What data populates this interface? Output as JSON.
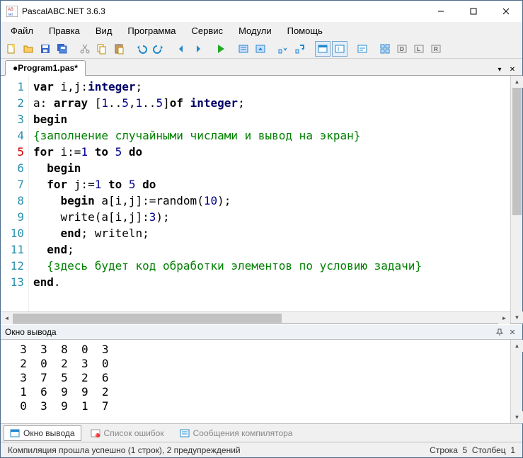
{
  "window": {
    "title": "PascalABC.NET 3.6.3"
  },
  "menus": [
    "Файл",
    "Правка",
    "Вид",
    "Программа",
    "Сервис",
    "Модули",
    "Помощь"
  ],
  "tab": {
    "label": "●Program1.pas*"
  },
  "gutter": {
    "lines": [
      "1",
      "2",
      "3",
      "4",
      "5",
      "6",
      "7",
      "8",
      "9",
      "10",
      "11",
      "12",
      "13"
    ],
    "current": 5
  },
  "code_lines": [
    {
      "segs": [
        {
          "t": "var ",
          "c": "kw"
        },
        {
          "t": "i,j:",
          "c": ""
        },
        {
          "t": "integer",
          "c": "type"
        },
        {
          "t": ";",
          "c": ""
        }
      ]
    },
    {
      "segs": [
        {
          "t": "a: ",
          "c": ""
        },
        {
          "t": "array ",
          "c": "kw"
        },
        {
          "t": "[",
          "c": ""
        },
        {
          "t": "1",
          "c": "num"
        },
        {
          "t": "..",
          "c": ""
        },
        {
          "t": "5",
          "c": "num"
        },
        {
          "t": ",",
          "c": ""
        },
        {
          "t": "1",
          "c": "num"
        },
        {
          "t": "..",
          "c": ""
        },
        {
          "t": "5",
          "c": "num"
        },
        {
          "t": "]",
          "c": ""
        },
        {
          "t": "of ",
          "c": "kw"
        },
        {
          "t": "integer",
          "c": "type"
        },
        {
          "t": ";",
          "c": ""
        }
      ]
    },
    {
      "segs": [
        {
          "t": "begin",
          "c": "kw"
        }
      ]
    },
    {
      "segs": [
        {
          "t": "{заполнение случайными числами и вывод на экран}",
          "c": "cmt"
        }
      ]
    },
    {
      "segs": [
        {
          "t": "for ",
          "c": "kw"
        },
        {
          "t": "i:=",
          "c": ""
        },
        {
          "t": "1",
          "c": "num"
        },
        {
          "t": " ",
          "c": ""
        },
        {
          "t": "to ",
          "c": "kw"
        },
        {
          "t": "5",
          "c": "num"
        },
        {
          "t": " ",
          "c": ""
        },
        {
          "t": "do",
          "c": "kw"
        }
      ]
    },
    {
      "segs": [
        {
          "t": "  ",
          "c": ""
        },
        {
          "t": "begin",
          "c": "kw"
        }
      ]
    },
    {
      "segs": [
        {
          "t": "  ",
          "c": ""
        },
        {
          "t": "for ",
          "c": "kw"
        },
        {
          "t": "j:=",
          "c": ""
        },
        {
          "t": "1",
          "c": "num"
        },
        {
          "t": " ",
          "c": ""
        },
        {
          "t": "to ",
          "c": "kw"
        },
        {
          "t": "5",
          "c": "num"
        },
        {
          "t": " ",
          "c": ""
        },
        {
          "t": "do",
          "c": "kw"
        }
      ]
    },
    {
      "segs": [
        {
          "t": "    ",
          "c": ""
        },
        {
          "t": "begin ",
          "c": "kw"
        },
        {
          "t": "a[i,j]:=random(",
          "c": ""
        },
        {
          "t": "10",
          "c": "num"
        },
        {
          "t": ");",
          "c": ""
        }
      ]
    },
    {
      "segs": [
        {
          "t": "    write(a[i,j]:",
          "c": ""
        },
        {
          "t": "3",
          "c": "num"
        },
        {
          "t": ");",
          "c": ""
        }
      ]
    },
    {
      "segs": [
        {
          "t": "    ",
          "c": ""
        },
        {
          "t": "end",
          "c": "kw"
        },
        {
          "t": "; writeln;",
          "c": ""
        }
      ]
    },
    {
      "segs": [
        {
          "t": "  ",
          "c": ""
        },
        {
          "t": "end",
          "c": "kw"
        },
        {
          "t": ";",
          "c": ""
        }
      ]
    },
    {
      "segs": [
        {
          "t": "  ",
          "c": ""
        },
        {
          "t": "{здесь будет код обработки элементов по условию задачи}",
          "c": "cmt"
        }
      ]
    },
    {
      "segs": [
        {
          "t": "end",
          "c": "kw"
        },
        {
          "t": ".",
          "c": ""
        }
      ]
    }
  ],
  "output": {
    "title": "Окно вывода",
    "text": "  3  3  8  0  3\n  2  0  2  3  0\n  3  7  5  2  6\n  1  6  9  9  2\n  0  3  9  1  7"
  },
  "bottom_tabs": {
    "output": "Окно вывода",
    "errors": "Список ошибок",
    "compiler": "Сообщения компилятора"
  },
  "status": {
    "left": "Компиляция прошла успешно (1 строк), 2 предупреждений",
    "line_label": "Строка",
    "line": "5",
    "col_label": "Столбец",
    "col": "1"
  }
}
